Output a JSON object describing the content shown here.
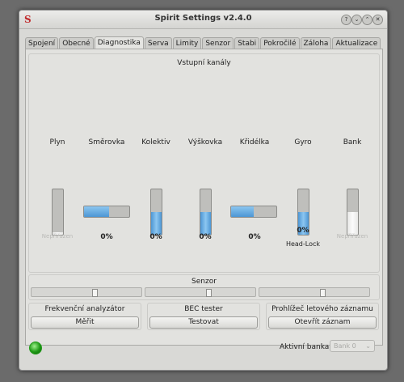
{
  "window": {
    "title": "Spirit Settings v2.4.0",
    "app_icon": "S",
    "buttons": {
      "help": "?",
      "minimize": "⌄",
      "maximize": "⌃",
      "close": "✕"
    }
  },
  "tabs": [
    {
      "label": "Spojení",
      "active": false
    },
    {
      "label": "Obecné",
      "active": false
    },
    {
      "label": "Diagnostika",
      "active": true
    },
    {
      "label": "Serva",
      "active": false
    },
    {
      "label": "Limity",
      "active": false
    },
    {
      "label": "Senzor",
      "active": false
    },
    {
      "label": "Stabi",
      "active": false
    },
    {
      "label": "Pokročilé",
      "active": false
    },
    {
      "label": "Záloha",
      "active": false
    },
    {
      "label": "Aktualizace",
      "active": false
    }
  ],
  "input_channels": {
    "title": "Vstupní kanály",
    "channels": [
      {
        "label": "Plyn",
        "orientation": "vertical",
        "fill_fraction": 0.05,
        "fill_color": "white",
        "value": "Nepřiřazen",
        "sub": ""
      },
      {
        "label": "Směrovka",
        "orientation": "horizontal",
        "fill_fraction": 0.55,
        "fill_color": "blue",
        "value": "0%",
        "sub": ""
      },
      {
        "label": "Kolektiv",
        "orientation": "vertical",
        "fill_fraction": 0.5,
        "fill_color": "blue",
        "value": "0%",
        "sub": ""
      },
      {
        "label": "Výškovka",
        "orientation": "vertical",
        "fill_fraction": 0.5,
        "fill_color": "blue",
        "value": "0%",
        "sub": ""
      },
      {
        "label": "Křidélka",
        "orientation": "horizontal",
        "fill_fraction": 0.5,
        "fill_color": "blue",
        "value": "0%",
        "sub": ""
      },
      {
        "label": "Gyro",
        "orientation": "vertical",
        "fill_fraction": 0.5,
        "fill_color": "blue",
        "value": "0%",
        "sub": "Head-Lock"
      },
      {
        "label": "Bank",
        "orientation": "vertical",
        "fill_fraction": 0.5,
        "fill_color": "white",
        "value": "Nepřiřazen",
        "sub": ""
      }
    ]
  },
  "sensor": {
    "title": "Senzor",
    "sliders": [
      0.58,
      0.58,
      0.58
    ]
  },
  "tools": [
    {
      "title": "Frekvenční analyzátor",
      "button": "Měřit"
    },
    {
      "title": "BEC tester",
      "button": "Testovat"
    },
    {
      "title": "Prohlížeč letového záznamu",
      "button": "Otevřít záznam"
    }
  ],
  "status": {
    "bank_label": "Aktivní banka:",
    "bank_value": "Bank 0",
    "led_color": "#1f9a16"
  }
}
